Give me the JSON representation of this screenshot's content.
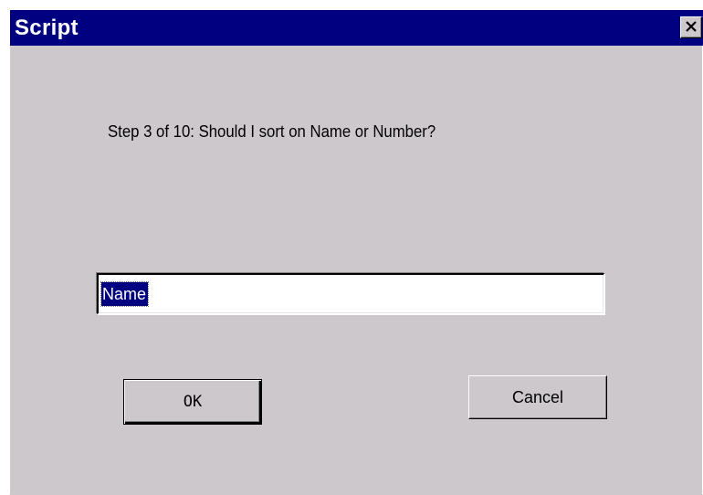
{
  "window": {
    "title": "Script",
    "close_icon": "close-x-icon"
  },
  "dialog": {
    "prompt": "Step 3 of 10: Should I sort on Name or Number?",
    "input_value": "Name",
    "ok_label": "OK",
    "cancel_label": "Cancel"
  },
  "colors": {
    "titlebar": "#000080",
    "dialog_bg": "#cdc8cb",
    "selection": "#000080",
    "text": "#000000",
    "title_text": "#ffffff"
  }
}
